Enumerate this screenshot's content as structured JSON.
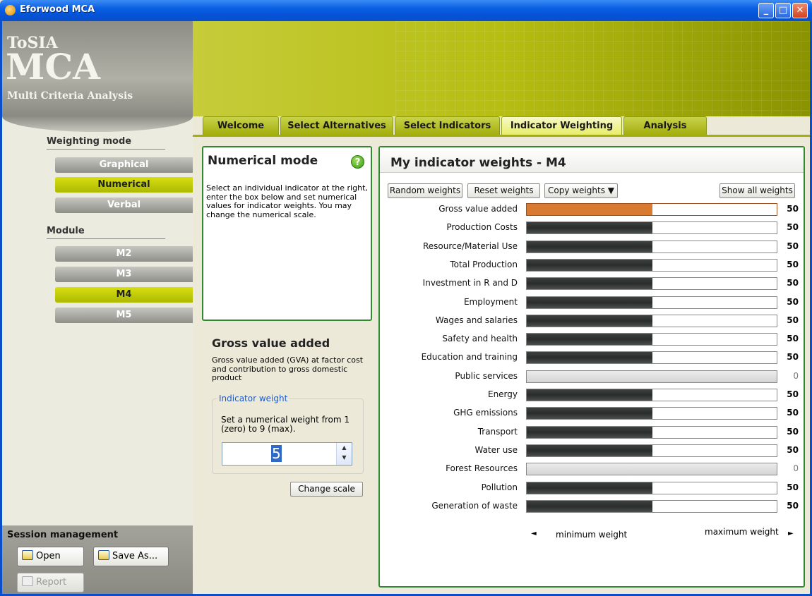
{
  "window": {
    "title": "Eforwood MCA",
    "minimize": "_",
    "maximize": "□",
    "close": "✕"
  },
  "logo": {
    "line1": "ToSIA",
    "line2": "MCA",
    "line3": "Multi Criteria Analysis"
  },
  "tabs": [
    {
      "label": "Welcome"
    },
    {
      "label": "Select Alternatives"
    },
    {
      "label": "Select Indicators"
    },
    {
      "label": "Indicator Weighting",
      "active": true
    },
    {
      "label": "Analysis"
    }
  ],
  "sidebar": {
    "weighting_mode_label": "Weighting mode",
    "modes": [
      {
        "label": "Graphical"
      },
      {
        "label": "Numerical",
        "active": true
      },
      {
        "label": "Verbal"
      }
    ],
    "module_label": "Module",
    "modules": [
      {
        "label": "M2"
      },
      {
        "label": "M3"
      },
      {
        "label": "M4",
        "active": true
      },
      {
        "label": "M5"
      }
    ]
  },
  "session": {
    "label": "Session management",
    "open": "Open",
    "save_as": "Save As...",
    "report": "Report"
  },
  "numerical_mode": {
    "title": "Numerical mode",
    "help": "?",
    "description": "Select an individual indicator at the right, enter the box below and set numerical values for indicator weights. You may change the numerical scale."
  },
  "indicator_detail": {
    "title": "Gross value added",
    "description": "Gross value added (GVA) at factor cost and contribution to gross domestic product",
    "weight_legend": "Indicator weight",
    "weight_instruction": "Set a numerical weight from 1 (zero) to 9 (max).",
    "weight_value": "5",
    "spin_up": "▲",
    "spin_down": "▼",
    "change_scale": "Change scale"
  },
  "weights_panel": {
    "title": "My indicator weights - M4",
    "random_weights": "Random weights",
    "reset_weights": "Reset weights",
    "copy_weights": "Copy weights ▼",
    "show_all_weights": "Show all weights",
    "axis_min": "minimum weight",
    "axis_max": "maximum weight",
    "axis_min_icon": "◄",
    "axis_max_icon": "►",
    "colors": {
      "selected": "#d87a30",
      "normal": "#3c403f",
      "zero": "#d4d4d4"
    },
    "indicators": [
      {
        "label": "Gross value added",
        "value": "50",
        "weight": 0.5,
        "selected": true
      },
      {
        "label": "Production Costs",
        "value": "50",
        "weight": 0.5
      },
      {
        "label": "Resource/Material Use",
        "value": "50",
        "weight": 0.5
      },
      {
        "label": "Total Production",
        "value": "50",
        "weight": 0.5
      },
      {
        "label": "Investment in R and D",
        "value": "50",
        "weight": 0.5
      },
      {
        "label": "Employment",
        "value": "50",
        "weight": 0.5
      },
      {
        "label": "Wages and salaries",
        "value": "50",
        "weight": 0.5
      },
      {
        "label": "Safety and health",
        "value": "50",
        "weight": 0.5
      },
      {
        "label": "Education and training",
        "value": "50",
        "weight": 0.5
      },
      {
        "label": "Public services",
        "value": "0",
        "weight": 0
      },
      {
        "label": "Energy",
        "value": "50",
        "weight": 0.5
      },
      {
        "label": "GHG emissions",
        "value": "50",
        "weight": 0.5
      },
      {
        "label": "Transport",
        "value": "50",
        "weight": 0.5
      },
      {
        "label": "Water use",
        "value": "50",
        "weight": 0.5
      },
      {
        "label": "Forest Resources",
        "value": "0",
        "weight": 0
      },
      {
        "label": "Pollution",
        "value": "50",
        "weight": 0.5
      },
      {
        "label": "Generation of waste",
        "value": "50",
        "weight": 0.5
      }
    ]
  }
}
